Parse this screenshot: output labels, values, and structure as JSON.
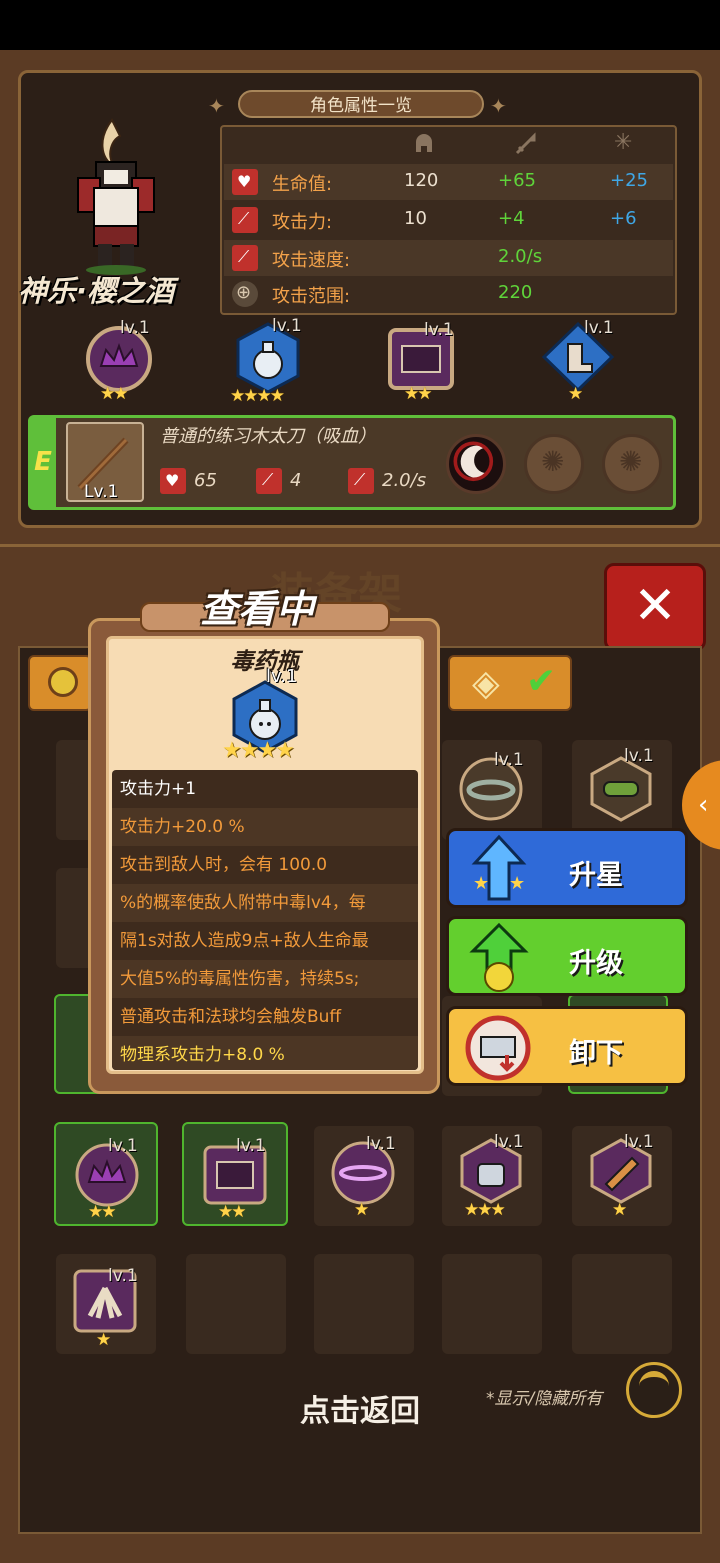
{
  "character": {
    "panel_title": "角色属性一览",
    "name": "神乐·樱之酒",
    "stats": [
      {
        "label": "生命值:",
        "base": "120",
        "bonus_green": "+65",
        "bonus_blue": "+25",
        "icon": "heart-icon",
        "color": "#c0312c"
      },
      {
        "label": "攻击力:",
        "base": "10",
        "bonus_green": "+4",
        "bonus_blue": "+6",
        "icon": "sword-icon",
        "color": "#c0312c"
      },
      {
        "label": "攻击速度:",
        "base": "",
        "bonus_green": "2.0/s",
        "bonus_blue": "",
        "icon": "speed-sword-icon",
        "color": "#c0312c"
      },
      {
        "label": "攻击范围:",
        "base": "",
        "bonus_green": "220",
        "bonus_blue": "",
        "icon": "crosshair-icon",
        "color": "#7a6a55"
      }
    ],
    "equipped": [
      {
        "level": "lv.1",
        "stars": "★★",
        "icon": "crown-icon"
      },
      {
        "level": "lv.1",
        "stars": "★★★★",
        "icon": "potion-icon"
      },
      {
        "level": "lv.1",
        "stars": "★★",
        "icon": "armor-icon"
      },
      {
        "level": "lv.1",
        "stars": "★",
        "icon": "boots-icon"
      }
    ],
    "weapon": {
      "tier": "E",
      "level": "Lv.1",
      "name": "普通的练习木太刀（吸血）",
      "hp": "65",
      "atk": "4",
      "speed": "2.0/s"
    }
  },
  "shelf": {
    "title": "装备架",
    "close_label": "✕",
    "side_tab": "‹",
    "return_label": "点击返回",
    "toggle_label": "*显示/隐藏所有",
    "grid_items": [
      {
        "level": "lv.1",
        "stars": "★★"
      },
      {
        "level": "lv.1",
        "stars": "★★"
      },
      {
        "level": "lv.1",
        "stars": "★"
      },
      {
        "level": "lv.1",
        "stars": "★★★"
      },
      {
        "level": "lv.1",
        "stars": "★"
      },
      {
        "level": "lv.1",
        "stars": "★"
      }
    ],
    "upper_levels": [
      "lv.1",
      "lv.1"
    ]
  },
  "popup": {
    "status": "查看中",
    "item_name": "毒药瓶",
    "item_level": "lv.1",
    "item_stars": "★★★★",
    "lines": [
      {
        "text": "攻击力+1",
        "color": "#ffffff"
      },
      {
        "text": "攻击力+20.0 %",
        "color": "#f29a3a"
      },
      {
        "text": "攻击到敌人时，会有 100.0",
        "color": "#f29a3a"
      },
      {
        "text": "%的概率使敌人附带中毒lv4，每",
        "color": "#f29a3a"
      },
      {
        "text": "隔1s对敌人造成9点+敌人生命最",
        "color": "#f29a3a"
      },
      {
        "text": "大值5%的毒属性伤害，持续5s;",
        "color": "#f29a3a"
      },
      {
        "text": "普通攻击和法球均会触发Buff",
        "color": "#f29a3a"
      },
      {
        "text": "物理系攻击力+8.0 %",
        "color": "#ffd84a"
      }
    ]
  },
  "actions": {
    "star_up": "升星",
    "level_up": "升级",
    "unequip": "卸下"
  }
}
